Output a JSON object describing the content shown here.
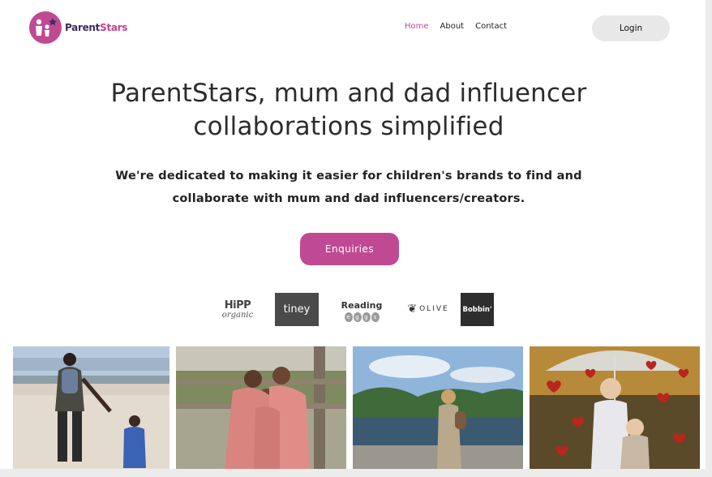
{
  "header": {
    "logo": {
      "part1": "Parent",
      "part2": "Stars"
    },
    "nav": [
      {
        "label": "Home",
        "active": true
      },
      {
        "label": "About",
        "active": false
      },
      {
        "label": "Contact",
        "active": false
      }
    ],
    "login_label": "Login"
  },
  "hero": {
    "title_line1": "ParentStars, mum and dad influencer",
    "title_line2": "collaborations simplified",
    "subtitle_line1": "We're dedicated to making it easier for children's brands to find and",
    "subtitle_line2": "collaborate with mum and dad influencers/creators.",
    "cta_label": "Enquiries"
  },
  "brands": {
    "hipp": {
      "line1": "HiPP",
      "line2": "organic"
    },
    "tiney": "tiney",
    "reading": {
      "line1": "Reading",
      "letters": [
        "e",
        "g",
        "g",
        "s"
      ]
    },
    "olive": "OLIVE",
    "bobbin": "Bobbin'"
  },
  "colors": {
    "accent": "#bf4a93",
    "nav_active": "#c04a92",
    "login_bg": "#e8e8e8",
    "logo_text": "#3b2a63"
  },
  "photos": [
    {
      "name": "father-child-beach-photo"
    },
    {
      "name": "three-girls-gate-photo"
    },
    {
      "name": "child-lake-photo"
    },
    {
      "name": "children-umbrella-hearts-photo"
    }
  ]
}
